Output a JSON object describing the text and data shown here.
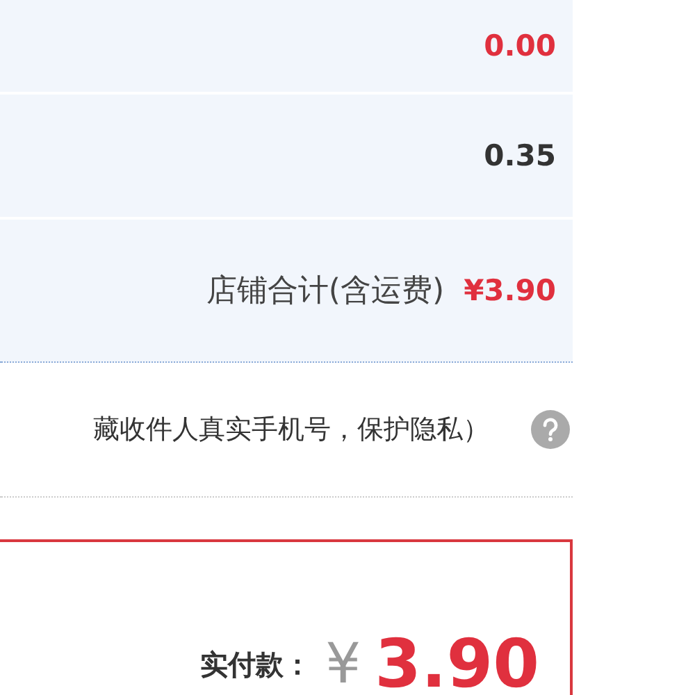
{
  "fee_rows": [
    {
      "value": "0.00",
      "highlight": true
    },
    {
      "value": "0.35",
      "highlight": false
    }
  ],
  "store_total": {
    "label": "店铺合计(含运费)",
    "amount": "¥3.90"
  },
  "privacy_note": {
    "text": "藏收件人真实手机号，保护隐私）"
  },
  "payment": {
    "label": "实付款：",
    "currency": "¥",
    "amount": "3.90"
  }
}
